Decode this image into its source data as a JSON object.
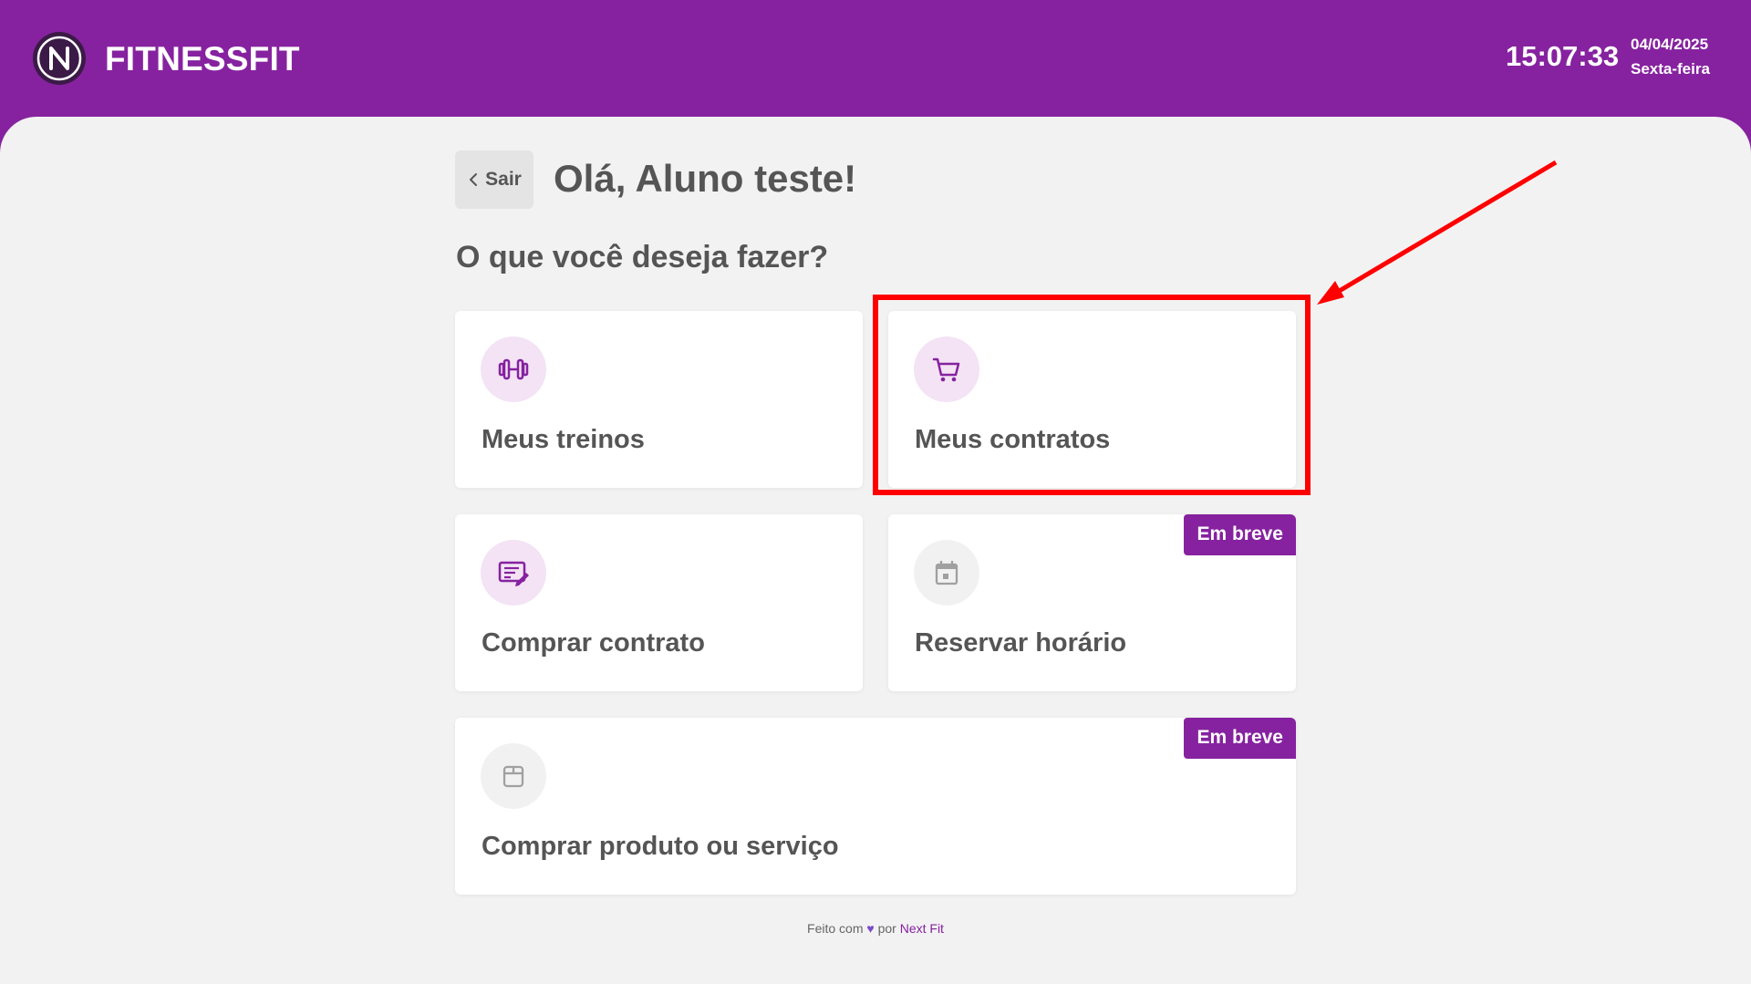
{
  "header": {
    "brand": "FITNESSFIT",
    "time": "15:07:33",
    "date": "04/04/2025",
    "weekday": "Sexta-feira",
    "background_color": "#86229f"
  },
  "page": {
    "back_label": "Sair",
    "greeting": "Olá, Aluno teste!",
    "question": "O que você deseja fazer?"
  },
  "cards": [
    {
      "title": "Meus treinos",
      "icon": "dumbbell-icon",
      "badge": null
    },
    {
      "title": "Meus contratos",
      "icon": "shopping-cart-icon",
      "badge": null
    },
    {
      "title": "Comprar contrato",
      "icon": "contract-edit-icon",
      "badge": null
    },
    {
      "title": "Reservar horário",
      "icon": "calendar-icon",
      "badge": "Em breve"
    },
    {
      "title": "Comprar produto ou serviço",
      "icon": "box-icon",
      "badge": "Em breve"
    }
  ],
  "footer": {
    "prefix": "Feito com",
    "middle": "por",
    "brand": "Next Fit"
  },
  "annotation": {
    "highlight_color": "#ff0000",
    "highlighted_card": "Meus contratos"
  }
}
